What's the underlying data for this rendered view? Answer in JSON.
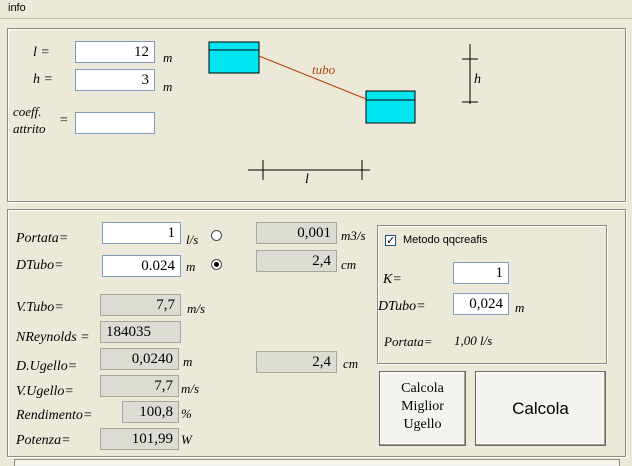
{
  "window": {
    "title": "info"
  },
  "geometry": {
    "l_label": "l =",
    "l_value": "12",
    "l_unit": "m",
    "h_label": "h =",
    "h_value": "3",
    "h_unit": "m",
    "coeff_label": "coeff.",
    "coeff_label2": "attrito",
    "coeff_eq": "=",
    "coeff_value": "",
    "diagram": {
      "tubo_label": "tubo",
      "h_label": "h",
      "l_label": "l"
    }
  },
  "flow": {
    "portata_label": "Portata=",
    "portata_value": "1",
    "portata_unit": "l/s",
    "portata_m3s_value": "0,001",
    "portata_m3s_unit": "m3/s",
    "dtubo_label": "DTubo=",
    "dtubo_value": "0.024",
    "dtubo_unit": "m",
    "dtubo_cm_value": "2,4",
    "dtubo_cm_unit": "cm",
    "selected_radio": "dtubo"
  },
  "results": {
    "vtubo_label": "V.Tubo=",
    "vtubo_value": "7,7",
    "vtubo_unit": "m/s",
    "nreynolds_label": "NReynolds =",
    "nreynolds_value": "184035",
    "dugello_label": "D.Ugello=",
    "dugello_value": "0,0240",
    "dugello_unit": "m",
    "dugello_cm_value": "2,4",
    "dugello_cm_unit": "cm",
    "vugello_label": "V.Ugello=",
    "vugello_value": "7,7",
    "vugello_unit": "m/s",
    "rendimento_label": "Rendimento=",
    "rendimento_value": "100,8",
    "rendimento_unit": "%",
    "potenza_label": "Potenza=",
    "potenza_value": "101,99",
    "potenza_unit": "W"
  },
  "method": {
    "checkbox_label": "Metodo qqcreafis",
    "checked": true,
    "k_label": "K=",
    "k_value": "1",
    "dtubo_label": "DTubo=",
    "dtubo_value": "0,024",
    "dtubo_unit": "m",
    "portata_label": "Portata=",
    "portata_text": "1,00 l/s"
  },
  "buttons": {
    "calcola_ugello_line1": "Calcola",
    "calcola_ugello_line2": "Miglior",
    "calcola_ugello_line3": "Ugello",
    "calcola_label": "Calcola"
  },
  "colors": {
    "tank": "#00e5f0",
    "pipe": "#b5400a",
    "tubo_text": "#b5400a"
  }
}
